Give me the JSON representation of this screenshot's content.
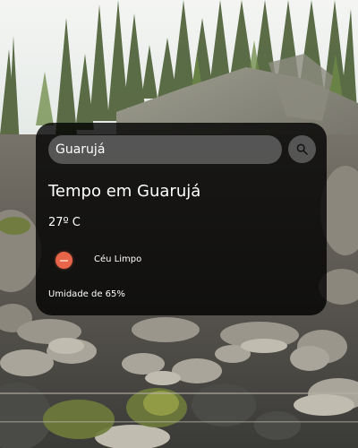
{
  "search": {
    "value": "Guarujá",
    "placeholder": ""
  },
  "weather": {
    "title": "Tempo em Guarujá",
    "temperature": "27º C",
    "condition": "Céu Limpo",
    "humidity": "Umidade de 65%",
    "icon": "sun-icon"
  },
  "colors": {
    "card_background": "#000000cc",
    "input_background": "#7c7c7c",
    "text": "#ffffff",
    "weather_icon": "#e8654a"
  },
  "background": {
    "icon": "forest-rocks-background"
  }
}
